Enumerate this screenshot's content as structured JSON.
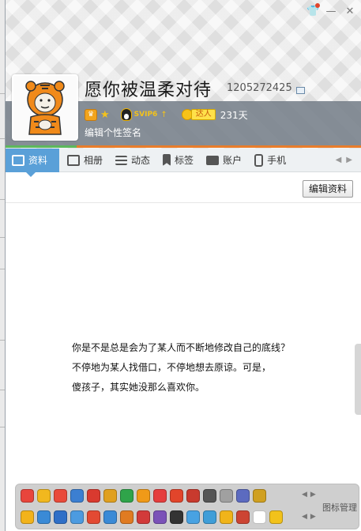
{
  "window": {
    "controls": [
      "skin-icon",
      "minimize-icon",
      "close-icon"
    ]
  },
  "profile": {
    "nickname": "愿你被温柔对待",
    "qq_number": "1205272425",
    "svip_label": "SVIP6",
    "daren_label": "达人",
    "days": "231天",
    "signature_placeholder": "编辑个性签名"
  },
  "tabs": [
    {
      "label": "资料",
      "icon": "profile-card-icon",
      "active": true
    },
    {
      "label": "相册",
      "icon": "photo-album-icon",
      "active": false
    },
    {
      "label": "动态",
      "icon": "feed-list-icon",
      "active": false
    },
    {
      "label": "标签",
      "icon": "bookmark-icon",
      "active": false
    },
    {
      "label": "账户",
      "icon": "wallet-icon",
      "active": false
    },
    {
      "label": "手机",
      "icon": "phone-icon",
      "active": false
    }
  ],
  "actions": {
    "edit_profile": "编辑资料"
  },
  "bio": {
    "lines": [
      "你是不是总是会为了某人而不断地修改自己的底线？",
      "不停地为某人找借口，不停地想去原谅。可是，",
      "傻孩子，其实她没那么喜欢你。"
    ]
  },
  "icon_panel": {
    "manage_label": "图标管理",
    "row1": [
      "#e8453c",
      "#f1b81e",
      "#e94a3a",
      "#3c7fd1",
      "#d93a2f",
      "#e0a020",
      "#2fa44a",
      "#f09a18",
      "#e53e3e",
      "#e2452b",
      "#c83a2e",
      "#555555",
      "#a0a0a0",
      "#5c6bc0",
      "#d0a020"
    ],
    "row2": [
      "#f2b31b",
      "#3a8ad6",
      "#2f6fc7",
      "#4c9be0",
      "#e34a33",
      "#3a8ad6",
      "#e07b22",
      "#d23a3a",
      "#7b52b8",
      "#333333",
      "#48a2e2",
      "#3f9ed8",
      "#f0b41a",
      "#cc4433",
      "#ffffff",
      "#f2c21b"
    ]
  },
  "colors": {
    "active_tab": "#5aa0d8",
    "accent_line": "#e97d2b",
    "info_band": "#6e7882"
  }
}
